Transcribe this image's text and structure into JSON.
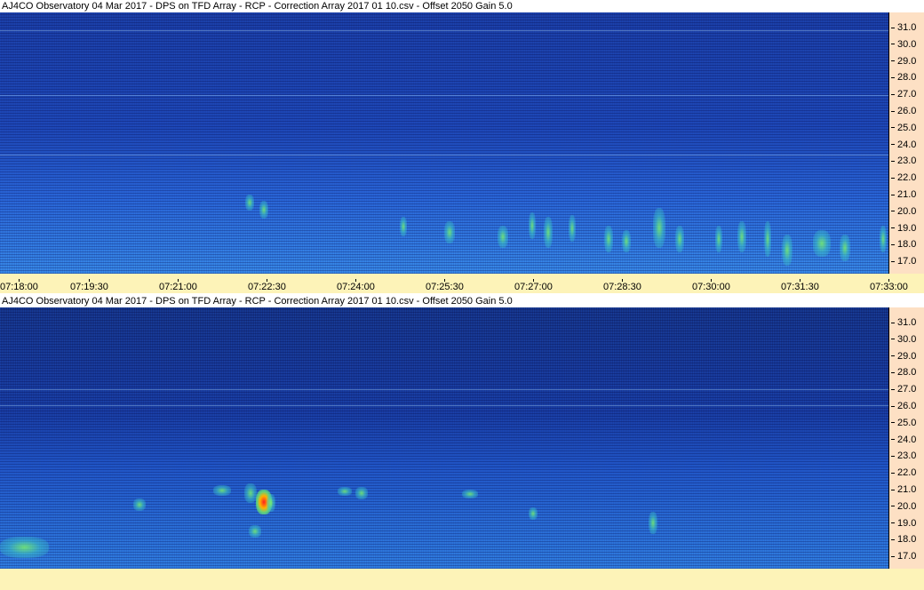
{
  "panels": [
    {
      "title": "AJ4CO Observatory 04 Mar 2017  -  DPS on TFD Array  -  RCP  -  Correction Array 2017 01 10.csv  -  Offset 2050  Gain 5.0",
      "y_ticks": [
        "31.0",
        "30.0",
        "29.0",
        "28.0",
        "27.0",
        "26.0",
        "25.0",
        "24.0",
        "23.0",
        "22.0",
        "21.0",
        "20.0",
        "19.0",
        "18.0",
        "17.0"
      ],
      "x_ticks": [
        "07:18:00",
        "07:19:30",
        "07:21:00",
        "07:22:30",
        "07:24:00",
        "07:25:30",
        "07:27:00",
        "07:28:30",
        "07:30:00",
        "07:31:30",
        "07:33:00"
      ]
    },
    {
      "title": "AJ4CO Observatory 04 Mar 2017  -  DPS on TFD Array  -  RCP  -  Correction Array 2017 01 10.csv  -  Offset 2050  Gain 5.0",
      "y_ticks": [
        "31.0",
        "30.0",
        "29.0",
        "28.0",
        "27.0",
        "26.0",
        "25.0",
        "24.0",
        "23.0",
        "22.0",
        "21.0",
        "20.0",
        "19.0",
        "18.0",
        "17.0"
      ],
      "x_ticks": []
    }
  ],
  "colors": {
    "axis_bg": "#fde0c4",
    "time_axis_bg": "#fdf3b8",
    "spectrogram_base": "#1b47b8"
  }
}
